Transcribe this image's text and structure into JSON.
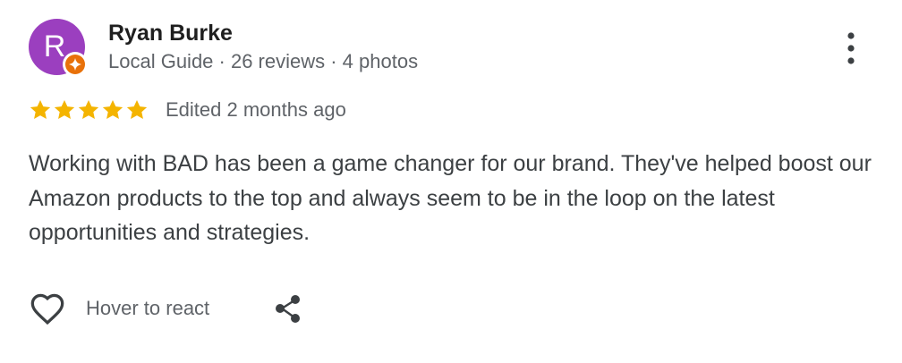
{
  "reviewer": {
    "name": "Ryan Burke",
    "avatar_letter": "R",
    "avatar_color": "#9b3fbf",
    "meta": "Local Guide · 26 reviews · 4 photos",
    "badge_icon": "local-guide-star-icon",
    "badge_color": "#e8710a"
  },
  "review": {
    "rating": 5,
    "rating_max": 5,
    "star_color": "#f4b400",
    "edited": "Edited 2 months ago",
    "text": "Working with BAD has been a game changer for our brand. They've helped boost our Amazon products to the top and always seem to be in the loop on the latest opportunities and strategies."
  },
  "actions": {
    "react_icon": "heart-outline-icon",
    "react_label": "Hover to react",
    "share_icon": "share-icon",
    "more_icon": "more-vert-icon"
  }
}
